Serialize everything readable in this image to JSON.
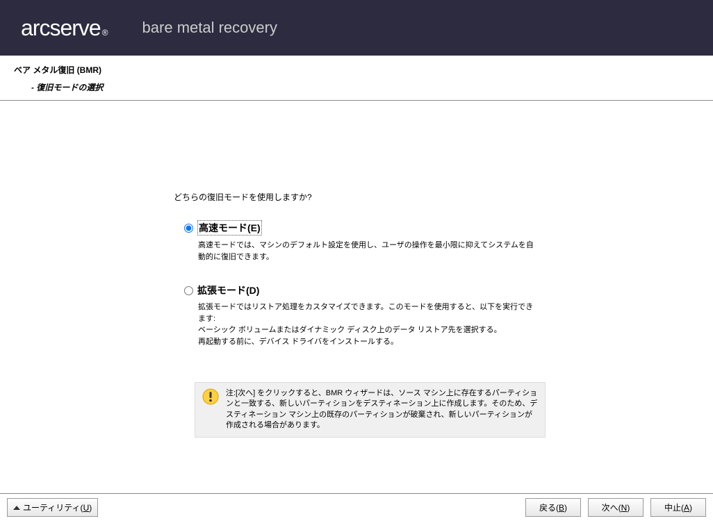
{
  "header": {
    "logo": "arcserve",
    "registered": "®",
    "subtitle": "bare metal recovery"
  },
  "breadcrumb": {
    "title": "ベア メタル復旧 (BMR)",
    "sub": "- 復旧モードの選択"
  },
  "content": {
    "question": "どちらの復旧モードを使用しますか?",
    "express": {
      "label": "高速モード(E)",
      "desc": "高速モードでは、マシンのデフォルト設定を使用し、ユーザの操作を最小限に抑えてシステムを自動的に復旧できます。"
    },
    "advanced": {
      "label": "拡張モード(D)",
      "desc_line1": "拡張モードではリストア処理をカスタマイズできます。このモードを使用すると、以下を実行できます:",
      "desc_line2": "ベーシック ボリュームまたはダイナミック ディスク上のデータ リストア先を選択する。",
      "desc_line3": "再起動する前に、デバイス ドライバをインストールする。"
    },
    "note": "注:[次へ] をクリックすると、BMR ウィザードは、ソース マシン上に存在するパーティションと一致する、新しいパーティションをデスティネーション上に作成します。そのため、デスティネーション マシン上の既存のパーティションが破棄され、新しいパーティションが作成される場合があります。"
  },
  "footer": {
    "utility_prefix": "ユーティリティ(",
    "utility_key": "U",
    "utility_suffix": ")",
    "back_prefix": "戻る(",
    "back_key": "B",
    "back_suffix": ")",
    "next_prefix": "次へ(",
    "next_key": "N",
    "next_suffix": ")",
    "abort_prefix": "中止(",
    "abort_key": "A",
    "abort_suffix": ")"
  }
}
